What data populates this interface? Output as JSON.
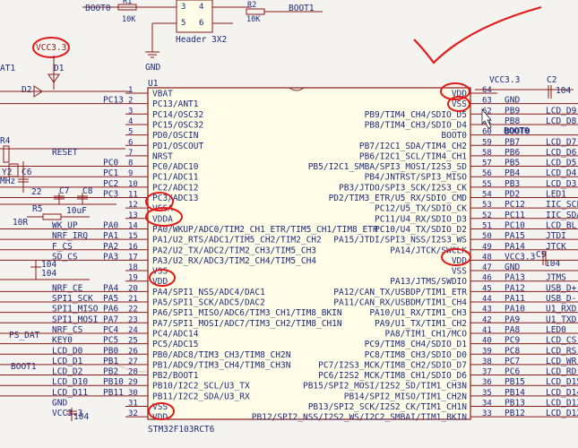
{
  "top": {
    "boot0_left": "BOOT0",
    "r1": "R1",
    "r1_val": "10K",
    "r2": "R2",
    "r2_val": "10K",
    "boot1_right": "BOOT1",
    "header_pins": [
      "3",
      "4",
      "5",
      "6"
    ],
    "header_label": "Header 3X2",
    "gnd": "GND"
  },
  "chip": {
    "ref": "U1",
    "part": "STM32F103RCT6",
    "left_pins": [
      {
        "num": "1",
        "name": "VBAT"
      },
      {
        "num": "2",
        "name": "PC13/ANT1"
      },
      {
        "num": "3",
        "name": "PC14/OSC32"
      },
      {
        "num": "4",
        "name": "PC15/OSC32"
      },
      {
        "num": "5",
        "name": "PD0/OSCIN"
      },
      {
        "num": "6",
        "name": "PD1/OSCOUT"
      },
      {
        "num": "7",
        "name": "NRST"
      },
      {
        "num": "8",
        "name": "PC0/ADC10"
      },
      {
        "num": "9",
        "name": "PC1/ADC11"
      },
      {
        "num": "10",
        "name": "PC2/ADC12"
      },
      {
        "num": "11",
        "name": "PC3/ADC13"
      },
      {
        "num": "12",
        "name": "VSSA"
      },
      {
        "num": "13",
        "name": "VDDA"
      },
      {
        "num": "14",
        "name": "PA0/WKUP/ADC0/TIM2_CH1_ETR/TIM5_CH1/TIM8_ETR"
      },
      {
        "num": "15",
        "name": "PA1/U2_RTS/ADC1/TIM5_CH2/TIM2_CH2"
      },
      {
        "num": "16",
        "name": "PA2/U2_TX/ADC2/TIM2_CH3/TIM5_CH3"
      },
      {
        "num": "17",
        "name": "PA3/U2_RX/ADC3/TIM2_CH4/TIM5_CH4"
      },
      {
        "num": "18",
        "name": "VSS"
      },
      {
        "num": "19",
        "name": "VDD"
      },
      {
        "num": "20",
        "name": "PA4/SPI1_NSS/ADC4/DAC1"
      },
      {
        "num": "21",
        "name": "PA5/SPI1_SCK/ADC5/DAC2"
      },
      {
        "num": "22",
        "name": "PA6/SPI1_MISO/ADC6/TIM3_CH1/TIM8_BKIN"
      },
      {
        "num": "23",
        "name": "PA7/SPI1_MOSI/ADC7/TIM3_CH2/TIM8_CH1N"
      },
      {
        "num": "24",
        "name": "PC4/ADC14"
      },
      {
        "num": "25",
        "name": "PC5/ADC15"
      },
      {
        "num": "26",
        "name": "PB0/ADC8/TIM3_CH3/TIM8_CH2N"
      },
      {
        "num": "27",
        "name": "PB1/ADC9/TIM3_CH4/TIM8_CH3N"
      },
      {
        "num": "28",
        "name": "PB2/BOOT1"
      },
      {
        "num": "29",
        "name": "PB10/I2C2_SCL/U3_TX"
      },
      {
        "num": "30",
        "name": "PB11/I2C2_SDA/U3_RX"
      },
      {
        "num": "31",
        "name": "VSS"
      },
      {
        "num": "32",
        "name": "VDD"
      }
    ],
    "right_pins": [
      {
        "num": "64",
        "name": "VDD"
      },
      {
        "num": "63",
        "name": "VSS"
      },
      {
        "num": "62",
        "name": "PB9/TIM4_CH4/SDIO_D5"
      },
      {
        "num": "61",
        "name": "PB8/TIM4_CH3/SDIO_D4"
      },
      {
        "num": "60",
        "name": "BOOT0"
      },
      {
        "num": "59",
        "name": "PB7/I2C1_SDA/TIM4_CH2"
      },
      {
        "num": "58",
        "name": "PB6/I2C1_SCL/TIM4_CH1"
      },
      {
        "num": "57",
        "name": "PB5/I2C1_SMBA/SPI3_MOSI/I2S3_SD"
      },
      {
        "num": "56",
        "name": "PB4/JNTRST/SPI3_MISO"
      },
      {
        "num": "55",
        "name": "PB3/JTDO/SPI3_SCK/I2S3_CK"
      },
      {
        "num": "54",
        "name": "PD2/TIM3_ETR/U5_RX/SDIO_CMD"
      },
      {
        "num": "53",
        "name": "PC12/U5_TX/SDIO_CK"
      },
      {
        "num": "52",
        "name": "PC11/U4_RX/SDIO_D3"
      },
      {
        "num": "51",
        "name": "PC10/U4_TX/SDIO_D2"
      },
      {
        "num": "50",
        "name": "PA15/JTDI/SPI3_NSS/I2S3_WS"
      },
      {
        "num": "49",
        "name": "PA14/JTCK/SWCLK"
      },
      {
        "num": "48",
        "name": "VDD"
      },
      {
        "num": "47",
        "name": "VSS"
      },
      {
        "num": "46",
        "name": "PA13/JTMS/SWDIO"
      },
      {
        "num": "45",
        "name": "PA12/CAN_TX/USBDP/TIM1_ETR"
      },
      {
        "num": "44",
        "name": "PA11/CAN_RX/USBDM/TIM1_CH4"
      },
      {
        "num": "43",
        "name": "PA10/U1_RX/TIM1_CH3"
      },
      {
        "num": "42",
        "name": "PA9/U1_TX/TIM1_CH2"
      },
      {
        "num": "41",
        "name": "PA8/TIM1_CH1/MCO"
      },
      {
        "num": "40",
        "name": "PC9/TIM8_CH4/SDIO_D1"
      },
      {
        "num": "39",
        "name": "PC8/TIM8_CH3/SDIO_D0"
      },
      {
        "num": "38",
        "name": "PC7/I2S3_MCK/TIM8_CH2/SDIO_D7"
      },
      {
        "num": "37",
        "name": "PC6/I2S2_MCK/TIM8_CH1/SDIO_D6"
      },
      {
        "num": "36",
        "name": "PB15/SPI2_MOSI/I2S2_SD/TIM1_CH3N"
      },
      {
        "num": "35",
        "name": "PB14/SPI2_MISO/TIM1_CH2N"
      },
      {
        "num": "34",
        "name": "PB13/SPI2_SCK/I2S2_CK/TIM1_CH1N"
      },
      {
        "num": "33",
        "name": "PB12/SPI2_NSS/I2S2_WS/I2C2_SMBAI/TIM1_BKIN"
      }
    ]
  },
  "left_nets": [
    {
      "label": "",
      "port": ""
    },
    {
      "label": "",
      "port": "PC13"
    },
    {
      "label": "",
      "port": ""
    },
    {
      "label": "",
      "port": ""
    },
    {
      "label": "",
      "port": ""
    },
    {
      "label": "",
      "port": ""
    },
    {
      "label": "RESET",
      "port": ""
    },
    {
      "label": "",
      "port": "PC0"
    },
    {
      "label": "",
      "port": "PC1"
    },
    {
      "label": "",
      "port": "PC2"
    },
    {
      "label": "",
      "port": "PC3"
    },
    {
      "label": "",
      "port": ""
    },
    {
      "label": "",
      "port": ""
    },
    {
      "label": "WK_UP",
      "port": "PA0"
    },
    {
      "label": "NRF_IRQ",
      "port": "PA1"
    },
    {
      "label": "F_CS",
      "port": "PA2"
    },
    {
      "label": "SD_CS",
      "port": "PA3"
    },
    {
      "label": "",
      "port": ""
    },
    {
      "label": "",
      "port": ""
    },
    {
      "label": "NRF_CE",
      "port": "PA4"
    },
    {
      "label": "SPI1_SCK",
      "port": "PA5"
    },
    {
      "label": "SPI1_MISO",
      "port": "PA6"
    },
    {
      "label": "SPI1_MOSI",
      "port": "PA7"
    },
    {
      "label": "NRF_CS",
      "port": "PC4"
    },
    {
      "label": "KEY0",
      "port": "PC5"
    },
    {
      "label": "LCD_D0",
      "port": "PB0"
    },
    {
      "label": "LCD_D1",
      "port": "PB1"
    },
    {
      "label": "LCD_D2",
      "port": "PB2"
    },
    {
      "label": "LCD_D10",
      "port": "PB10"
    },
    {
      "label": "LCD_D11",
      "port": "PB11"
    },
    {
      "label": "GND",
      "port": ""
    },
    {
      "label": "VCC3.3",
      "port": ""
    }
  ],
  "right_nets": [
    {
      "port": "",
      "label": ""
    },
    {
      "port": "GND",
      "label": ""
    },
    {
      "port": "PB9",
      "label": "LCD_D9"
    },
    {
      "port": "PB8",
      "label": "LCD_D8"
    },
    {
      "port": "BOOT0",
      "label": ""
    },
    {
      "port": "PB7",
      "label": "LCD_D7"
    },
    {
      "port": "PB6",
      "label": "LCD_D6"
    },
    {
      "port": "PB5",
      "label": "LCD_D5"
    },
    {
      "port": "PB4",
      "label": "LCD_D4"
    },
    {
      "port": "PB3",
      "label": "LCD_D3"
    },
    {
      "port": "PD2",
      "label": "LED1"
    },
    {
      "port": "PC12",
      "label": "IIC_SCL"
    },
    {
      "port": "PC11",
      "label": "IIC_SDA"
    },
    {
      "port": "PC10",
      "label": "LCD_BL"
    },
    {
      "port": "PA15",
      "label": "JTDI"
    },
    {
      "port": "PA14",
      "label": "JTCK"
    },
    {
      "port": "VCC3.3",
      "label": ""
    },
    {
      "port": "GND",
      "label": ""
    },
    {
      "port": "PA13",
      "label": "JTMS"
    },
    {
      "port": "PA12",
      "label": "USB_D+"
    },
    {
      "port": "PA11",
      "label": "USB_D-"
    },
    {
      "port": "PA10",
      "label": "U1_RXD"
    },
    {
      "port": "PA9",
      "label": "U1_TXD"
    },
    {
      "port": "PA8",
      "label": "LED0"
    },
    {
      "port": "PC9",
      "label": "LCD_CS"
    },
    {
      "port": "PC8",
      "label": "LCD_RS"
    },
    {
      "port": "PC7",
      "label": "LCD_WR"
    },
    {
      "port": "PC6",
      "label": "LCD_RD"
    },
    {
      "port": "PB15",
      "label": "LCD_D15"
    },
    {
      "port": "PB14",
      "label": "LCD_D14"
    },
    {
      "port": "PB13",
      "label": "LCD_D13"
    },
    {
      "port": "PB12",
      "label": "LCD_D12"
    }
  ],
  "left_side": {
    "vcc": "VCC3.3",
    "bat": "AT1",
    "d1": "D1",
    "d2": "D2",
    "r4": "R4",
    "y2": "Y2",
    "mhz": "MHz",
    "c6": "C6",
    "c7": "C7",
    "c8": "C8",
    "r5": "R5",
    "c22": "22",
    "r10k": "10R",
    "r5_val": "10R",
    "cap_10uf": "10uF",
    "cap_104a": "104",
    "cap_104b": "104",
    "ps_dat": "PS_DAT",
    "boot1": "BOOT1",
    "cap_bottom": "104",
    "vcc_bottom": "VCC3.3",
    "gnd_label": "GND"
  },
  "right_side": {
    "vcc": "VCC3.3",
    "c2": "C2",
    "c2_val": "104",
    "c9": "C9",
    "c9_val": "104",
    "gnd": "GND",
    "boot0": "BOOT0"
  },
  "colors": {
    "wire": "#8a1a1a",
    "text": "#1d2a7a",
    "circle": "#e01a1a",
    "background": "#f4f3ef"
  }
}
